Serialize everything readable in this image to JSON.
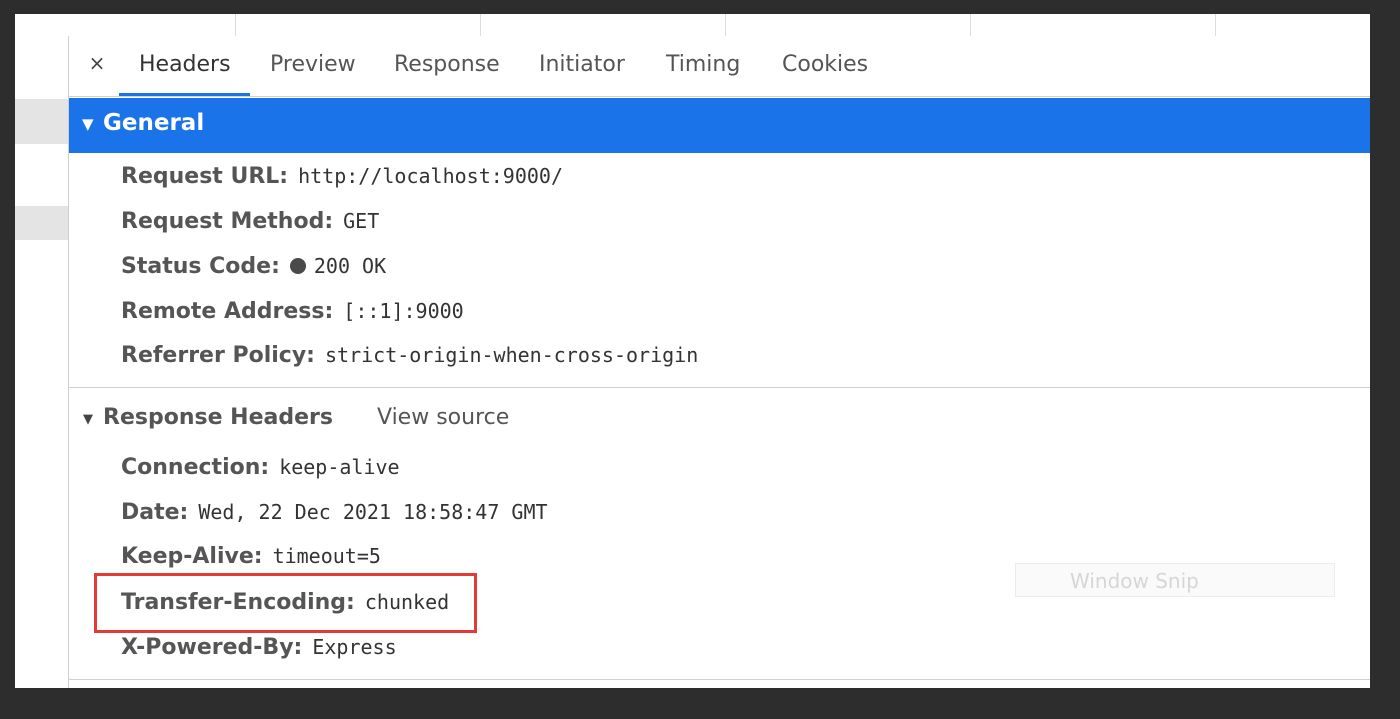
{
  "tabs": [
    {
      "label": "Headers",
      "active": true
    },
    {
      "label": "Preview"
    },
    {
      "label": "Response"
    },
    {
      "label": "Initiator"
    },
    {
      "label": "Timing"
    },
    {
      "label": "Cookies"
    }
  ],
  "close_glyph": "×",
  "general": {
    "title": "General",
    "rows": [
      {
        "key": "Request URL:",
        "value": "http://localhost:9000/"
      },
      {
        "key": "Request Method:",
        "value": "GET"
      },
      {
        "key": "Status Code:",
        "value": "200 OK"
      },
      {
        "key": "Remote Address:",
        "value": "[::1]:9000"
      },
      {
        "key": "Referrer Policy:",
        "value": "strict-origin-when-cross-origin"
      }
    ]
  },
  "response_headers": {
    "title": "Response Headers",
    "view_source_label": "View source",
    "rows": [
      {
        "key": "Connection:",
        "value": "keep-alive"
      },
      {
        "key": "Date:",
        "value": "Wed, 22 Dec 2021 18:58:47 GMT"
      },
      {
        "key": "Keep-Alive:",
        "value": "timeout=5"
      },
      {
        "key": "Transfer-Encoding:",
        "value": "chunked"
      },
      {
        "key": "X-Powered-By:",
        "value": "Express"
      }
    ]
  },
  "watermark": "Window Snip",
  "colors": {
    "accent": "#1a73e8",
    "highlight": "#e53935",
    "status_dot": "#4a4a4a"
  }
}
